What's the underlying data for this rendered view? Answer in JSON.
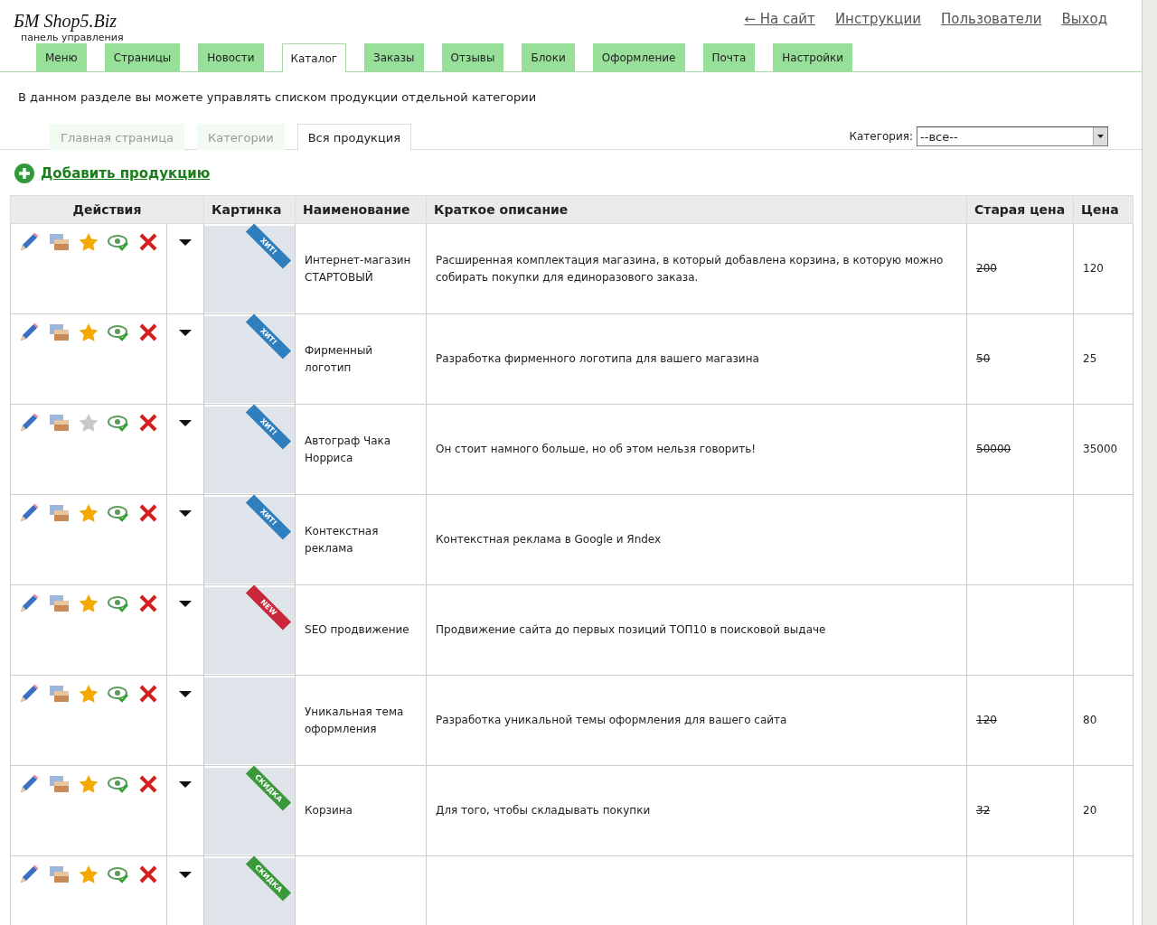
{
  "logo": {
    "title": "БМ Shop5.Biz",
    "subtitle": "панель управления"
  },
  "top_links": [
    "← На сайт",
    "Инструкции",
    "Пользователи",
    "Выход"
  ],
  "main_tabs": [
    {
      "label": "Меню",
      "selected": false
    },
    {
      "label": "Страницы",
      "selected": false
    },
    {
      "label": "Новости",
      "selected": false
    },
    {
      "label": "Каталог",
      "selected": true
    },
    {
      "label": "Заказы",
      "selected": false
    },
    {
      "label": "Отзывы",
      "selected": false
    },
    {
      "label": "Блоки",
      "selected": false
    },
    {
      "label": "Оформление",
      "selected": false
    },
    {
      "label": "Почта",
      "selected": false
    },
    {
      "label": "Настройки",
      "selected": false
    }
  ],
  "intro": "В данном разделе вы можете управлять списком продукции отдельной категории",
  "sub_tabs": [
    {
      "label": "Главная страница",
      "selected": false
    },
    {
      "label": "Категории",
      "selected": false
    },
    {
      "label": "Вся продукция",
      "selected": true
    }
  ],
  "category_filter": {
    "label": "Категория:",
    "value": "--все--"
  },
  "add_link": "Добавить продукцию",
  "table": {
    "columns": [
      "Действия",
      "Картинка",
      "Наименование",
      "Краткое описание",
      "Старая цена",
      "Цена"
    ],
    "rows": [
      {
        "featured": true,
        "badge": {
          "text": "ХИТ!",
          "color": "#2f7fbf"
        },
        "name": "Интернет-магазин СТАРТОВЫЙ",
        "description": "Расширенная комплектация магазина, в который добавлена корзина, в которую можно собирать покупки для единоразового заказа.",
        "old_price": "200",
        "price": "120"
      },
      {
        "featured": true,
        "badge": {
          "text": "ХИТ!",
          "color": "#2f7fbf"
        },
        "name": "Фирменный логотип",
        "description": "Разработка фирменного логотипа для вашего магазина",
        "old_price": "50",
        "price": "25"
      },
      {
        "featured": false,
        "badge": {
          "text": "ХИТ!",
          "color": "#2f7fbf"
        },
        "name": "Автограф Чака Норриса",
        "description": "Он стоит намного больше, но об этом нельзя говорить!",
        "old_price": "50000",
        "price": "35000"
      },
      {
        "featured": true,
        "badge": {
          "text": "ХИТ!",
          "color": "#2f7fbf"
        },
        "name": "Контекстная реклама",
        "description": "Контекстная реклама в Google и Яndex"
      },
      {
        "featured": true,
        "badge": {
          "text": "NEW",
          "color": "#c8283a"
        },
        "name": "SEO продвижение",
        "description": "Продвижение сайта до первых позиций ТОП10 в поисковой выдаче"
      },
      {
        "featured": true,
        "name": "Уникальная тема оформления",
        "description": "Разработка уникальной темы оформления для вашего сайта",
        "old_price": "120",
        "price": "80"
      },
      {
        "featured": true,
        "badge": {
          "text": "СКИДКА",
          "color": "#3a9a3a"
        },
        "name": "Корзина",
        "description": "Для того, чтобы складывать покупки",
        "old_price": "32",
        "price": "20"
      },
      {
        "featured": true,
        "badge": {
          "text": "СКИДКА",
          "color": "#3a9a3a"
        }
      }
    ]
  }
}
